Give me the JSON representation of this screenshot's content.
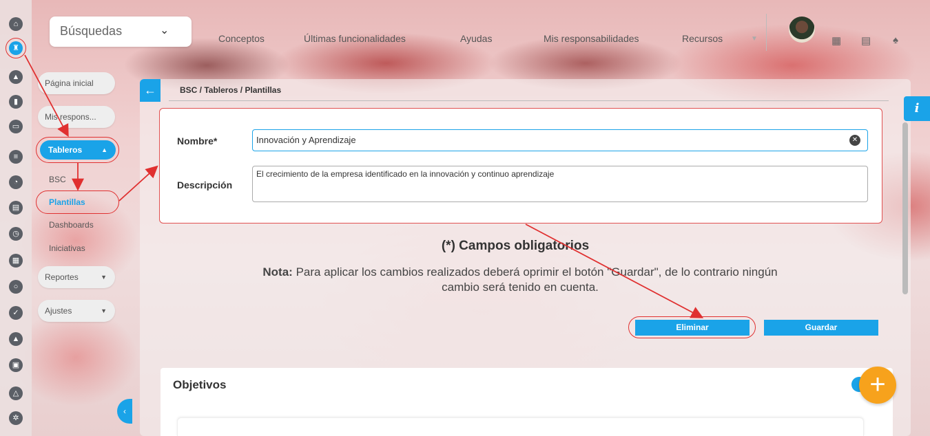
{
  "topbar": {
    "search_label": "Búsquedas",
    "nav": [
      "Conceptos",
      "Últimas funcionalidades",
      "Ayudas",
      "Mis responsabilidades",
      "Recursos"
    ]
  },
  "sidebar": {
    "items": [
      {
        "label": "Página inicial"
      },
      {
        "label": "Mis respons..."
      },
      {
        "label": "Tableros"
      }
    ],
    "subitems": [
      "BSC",
      "Plantillas",
      "Dashboards",
      "Iniciativas"
    ],
    "reportes": "Reportes",
    "ajustes": "Ajustes"
  },
  "breadcrumb": "BSC / Tableros / Plantillas",
  "form": {
    "nombre_label": "Nombre*",
    "nombre_value": "Innovación y Aprendizaje",
    "descripcion_label": "Descripción",
    "descripcion_value": "El crecimiento de la empresa identificado en la innovación y continuo aprendizaje"
  },
  "required_note": "(*) Campos obligatorios",
  "note": {
    "prefix": "Nota:",
    "text": "Para aplicar los cambios realizados deberá oprimir el botón \"Guardar\", de lo contrario ningún cambio será tenido en cuenta."
  },
  "buttons": {
    "eliminar": "Eliminar",
    "guardar": "Guardar"
  },
  "objetivos_title": "Objetivos",
  "info_label": "i",
  "accent_color": "#1aa3e8",
  "annotation_color": "#e03030",
  "fab_color": "#f7a21c"
}
